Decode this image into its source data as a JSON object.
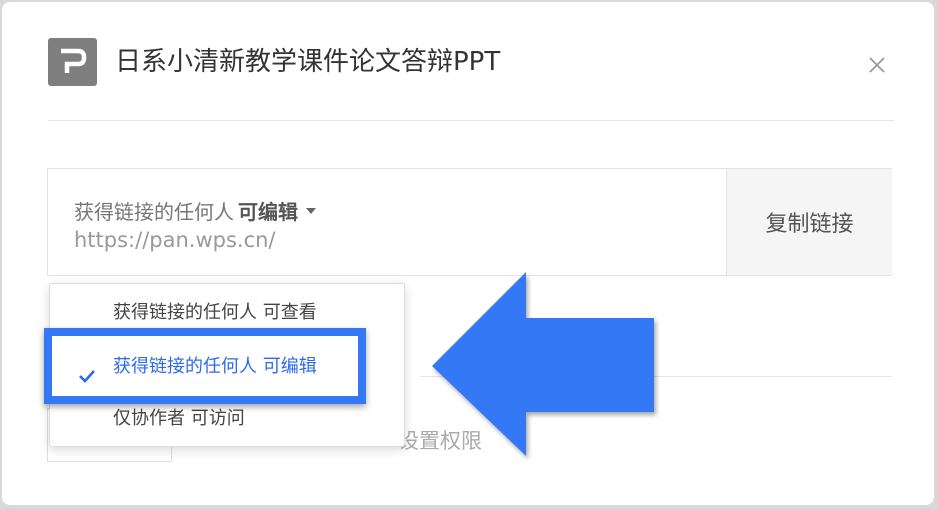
{
  "header": {
    "logo_icon": "wps-presentation-icon",
    "title": "日系小清新教学课件论文答辩PPT",
    "close_icon": "close-icon"
  },
  "share": {
    "permission_prefix": "获得链接的任何人",
    "permission_value": "可编辑",
    "url": "https://pan.wps.cn/",
    "copy_label": "复制链接"
  },
  "dropdown": {
    "options": [
      {
        "label": "获得链接的任何人 可查看",
        "selected": false
      },
      {
        "label": "获得链接的任何人 可编辑",
        "selected": true
      },
      {
        "label": "仅协作者 可访问",
        "selected": false
      }
    ]
  },
  "background": {
    "partial_text": "设置权限"
  },
  "annotation": {
    "highlight_color": "#3578f6",
    "arrow_color": "#3578f6",
    "arrow_icon": "left-arrow-icon"
  }
}
